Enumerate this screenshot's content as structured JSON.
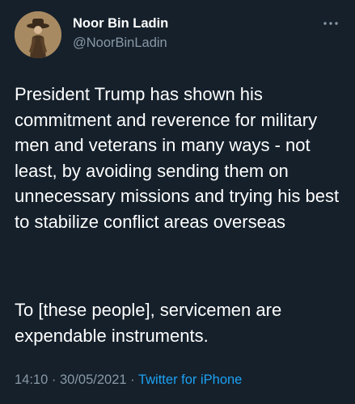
{
  "user": {
    "display_name": "Noor Bin Ladin",
    "handle": "@NoorBinLadin"
  },
  "tweet": {
    "paragraphs": [
      "President Trump has shown his commitment and reverence for military men and veterans in many ways - not least, by avoiding sending them on unnecessary missions and trying his best to stabilize conflict areas overseas",
      "To [these people], servicemen are expendable instruments."
    ],
    "time": "14:10",
    "date": "30/05/2021",
    "separator": "·",
    "source": "Twitter for iPhone"
  },
  "icons": {
    "avatar": "profile-photo",
    "more": "more-options-icon"
  },
  "colors": {
    "background": "#15202b",
    "text": "#ffffff",
    "secondary": "#8899a6",
    "link": "#1da1f2"
  }
}
